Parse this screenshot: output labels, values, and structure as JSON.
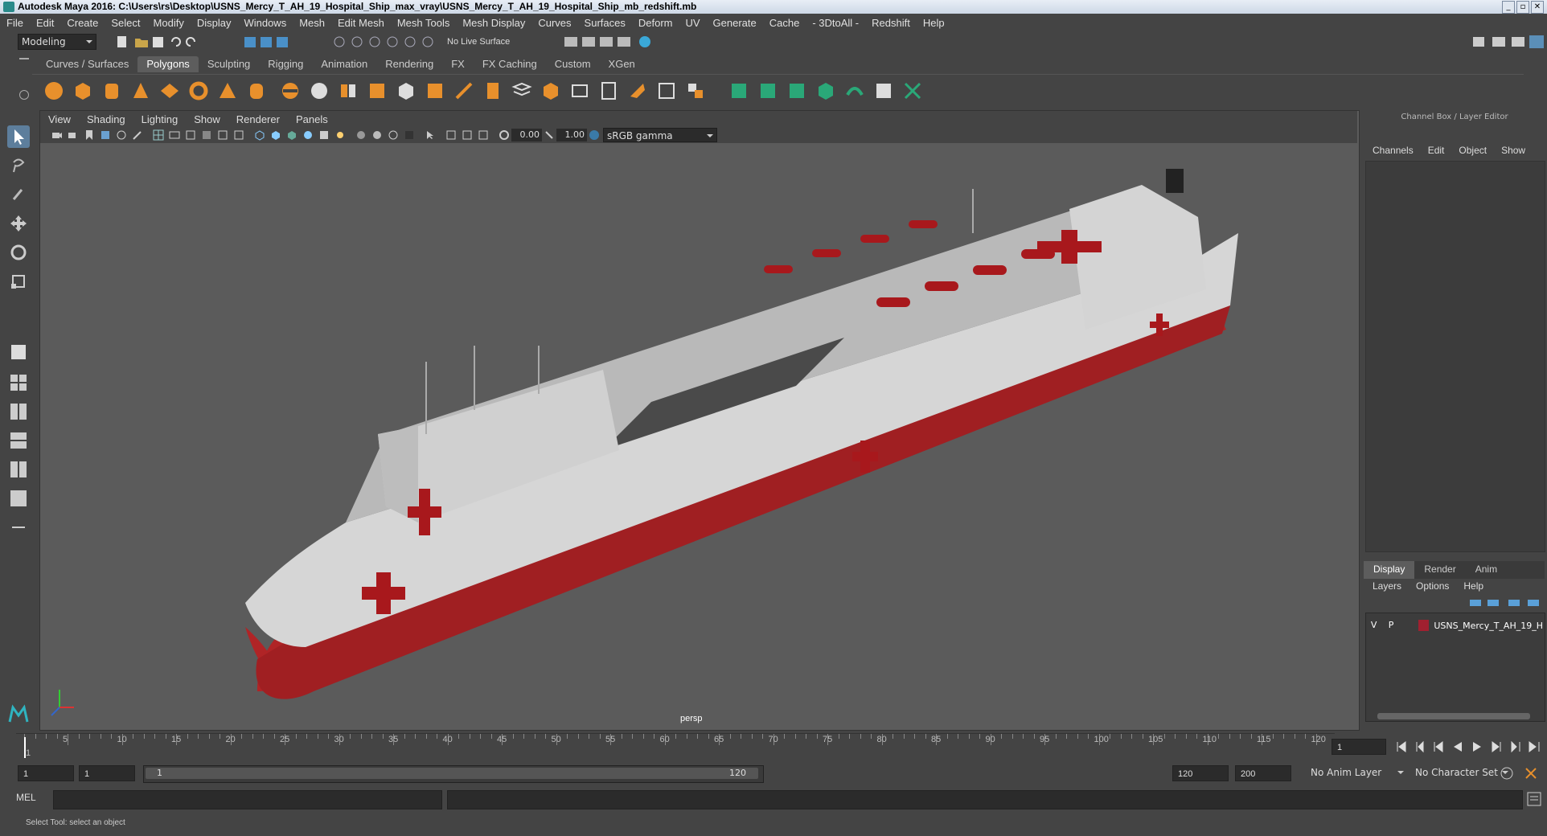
{
  "window": {
    "title": "Autodesk Maya 2016: C:\\Users\\rs\\Desktop\\USNS_Mercy_T_AH_19_Hospital_Ship_max_vray\\USNS_Mercy_T_AH_19_Hospital_Ship_mb_redshift.mb",
    "minimize": "_",
    "maximize": "▫",
    "close": "✕"
  },
  "menubar": [
    "File",
    "Edit",
    "Create",
    "Select",
    "Modify",
    "Display",
    "Windows",
    "Mesh",
    "Edit Mesh",
    "Mesh Tools",
    "Mesh Display",
    "Curves",
    "Surfaces",
    "Deform",
    "UV",
    "Generate",
    "Cache",
    "- 3DtoAll -",
    "Redshift",
    "Help"
  ],
  "statusline": {
    "mode_select": "Modeling",
    "live_surface": "No Live Surface"
  },
  "shelf": {
    "tabs": [
      "Curves / Surfaces",
      "Polygons",
      "Sculpting",
      "Rigging",
      "Animation",
      "Rendering",
      "FX",
      "FX Caching",
      "Custom",
      "XGen"
    ],
    "active_tab": "Polygons"
  },
  "viewport": {
    "menu": [
      "View",
      "Shading",
      "Lighting",
      "Show",
      "Renderer",
      "Panels"
    ],
    "exposure": "0.00",
    "gamma": "1.00",
    "color_space": "sRGB gamma",
    "camera_label": "persp"
  },
  "channel_box": {
    "header": "Channel Box / Layer Editor",
    "menu": [
      "Channels",
      "Edit",
      "Object",
      "Show"
    ]
  },
  "layer_editor": {
    "tabs": [
      "Display",
      "Render",
      "Anim"
    ],
    "active_tab": "Display",
    "menu": [
      "Layers",
      "Options",
      "Help"
    ],
    "layers": [
      {
        "visible": "V",
        "playback": "P",
        "name": "USNS_Mercy_T_AH_19_H",
        "color": "#a02030"
      }
    ]
  },
  "timeline": {
    "ticks": [
      "5",
      "10",
      "15",
      "20",
      "25",
      "30",
      "35",
      "40",
      "45",
      "50",
      "55",
      "60",
      "65",
      "70",
      "75",
      "80",
      "85",
      "90",
      "95",
      "100",
      "105",
      "110",
      "115",
      "120"
    ],
    "start_label": "1",
    "current_frame": "1"
  },
  "range": {
    "start": "1",
    "current": "1",
    "slider_start": "1",
    "slider_end": "120",
    "end": "120",
    "total_end": "200",
    "anim_layer": "No Anim Layer",
    "character_set": "No Character Set"
  },
  "command_line": {
    "label": "MEL"
  },
  "help_line": "Select Tool: select an object",
  "colors": {
    "hull_red": "#b02426",
    "hull_white": "#d8d8d8",
    "cross_red": "#a8181c",
    "viewport_bg": "#5b5b5b"
  }
}
